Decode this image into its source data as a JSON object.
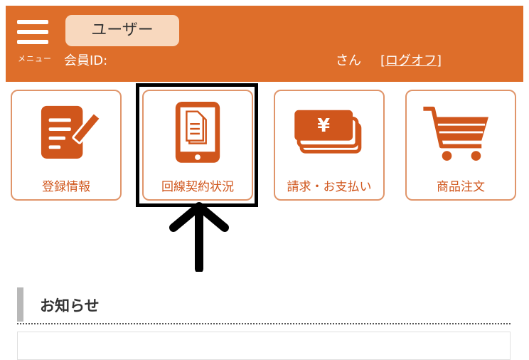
{
  "header": {
    "menu_label": "メニュー",
    "user_badge": "ユーザー",
    "member_id_label": "会員ID:",
    "san": "さん",
    "logoff_open": "[",
    "logoff_label": "ログオフ",
    "logoff_close": "]"
  },
  "tiles": [
    {
      "label": "登録情報",
      "icon": "edit-document-icon"
    },
    {
      "label": "回線契約状況",
      "icon": "tablet-documents-icon"
    },
    {
      "label": "請求・お支払い",
      "icon": "yen-cards-icon"
    },
    {
      "label": "商品注文",
      "icon": "shopping-cart-icon"
    }
  ],
  "notice": {
    "title": "お知らせ"
  },
  "colors": {
    "brand_orange": "#DE6E2A",
    "icon_orange": "#D0561C",
    "badge_bg": "#F8D8BE",
    "tile_border": "#E0956A"
  }
}
